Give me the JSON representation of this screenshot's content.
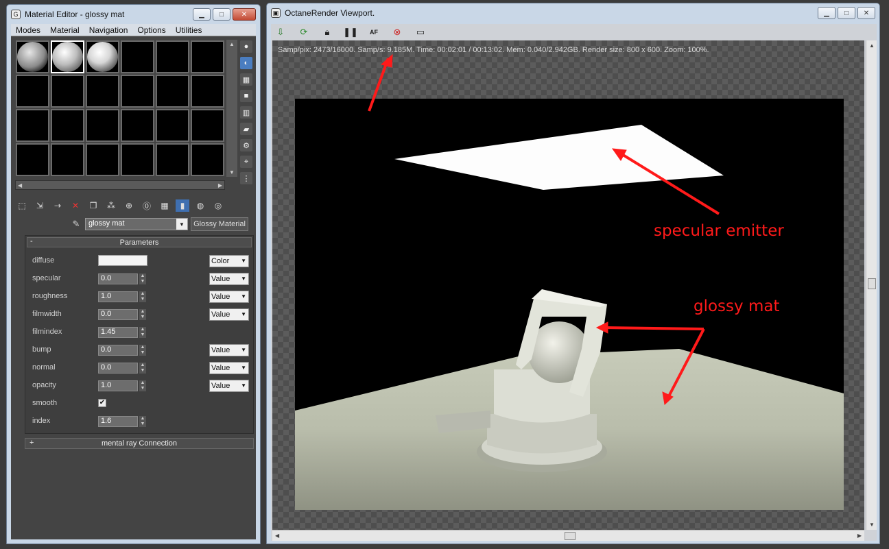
{
  "material_editor": {
    "title": "Material Editor - glossy mat",
    "menu": [
      "Modes",
      "Material",
      "Navigation",
      "Options",
      "Utilities"
    ],
    "material_name": "glossy mat",
    "material_type": "Glossy Material",
    "rollout_title": "Parameters",
    "rollout_sign": "-",
    "params": [
      {
        "label": "diffuse",
        "kind": "color",
        "mode": "Color"
      },
      {
        "label": "specular",
        "kind": "spin",
        "value": "0.0",
        "mode": "Value"
      },
      {
        "label": "roughness",
        "kind": "spin",
        "value": "1.0",
        "mode": "Value"
      },
      {
        "label": "filmwidth",
        "kind": "spin",
        "value": "0.0",
        "mode": "Value"
      },
      {
        "label": "filmindex",
        "kind": "spin",
        "value": "1.45"
      },
      {
        "label": "bump",
        "kind": "spin",
        "value": "0.0",
        "mode": "Value"
      },
      {
        "label": "normal",
        "kind": "spin",
        "value": "0.0",
        "mode": "Value"
      },
      {
        "label": "opacity",
        "kind": "spin",
        "value": "1.0",
        "mode": "Value"
      },
      {
        "label": "smooth",
        "kind": "check",
        "checked": true
      },
      {
        "label": "index",
        "kind": "spin",
        "value": "1.6"
      }
    ],
    "rollout2_title": "mental ray Connection",
    "rollout2_sign": "+"
  },
  "octane": {
    "title": "OctaneRender Viewport.",
    "status": "Samp/pix: 2473/16000.   Samp/s: 9.185M.   Time: 00:02:01 / 00:13:02.   Mem: 0.040/2.942GB.   Render size: 800 x 600.   Zoom: 100%."
  },
  "annotations": {
    "emitter": "specular emitter",
    "material": "glossy mat",
    "color": "#ff1a1a"
  }
}
